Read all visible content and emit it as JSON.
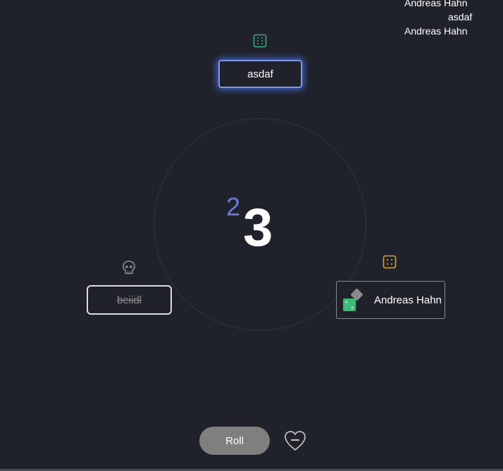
{
  "log": [
    "Andreas Hahn",
    "asdaf",
    "Andreas Hahn"
  ],
  "counter": {
    "small": "2",
    "big": "3"
  },
  "players": {
    "top": {
      "name": "asdaf",
      "die_face": 6,
      "die_color": "#3fa67a"
    },
    "left": {
      "name": "beiidl",
      "status": "skull-icon"
    },
    "right": {
      "name": "Andreas Hahn",
      "die_face": 4,
      "die_color": "#d8a03c"
    }
  },
  "controls": {
    "roll_label": "Roll",
    "heart": "heart-minus-icon"
  },
  "colors": {
    "background": "#20222b",
    "accent_blue": "#7f98ea",
    "counter_small": "#6c7ad8",
    "avatar_green": "#3cba7a"
  }
}
